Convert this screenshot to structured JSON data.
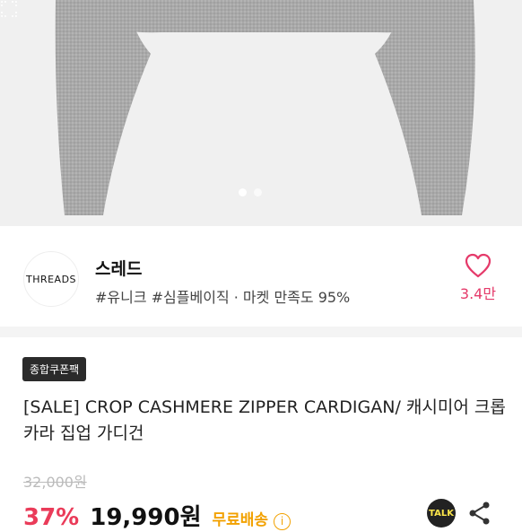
{
  "gallery": {
    "slide_count": 2,
    "active_slide": 1
  },
  "shop": {
    "logo_text": "THREADS",
    "name": "스레드",
    "tags": "#유니크 #심플베이직 · 마켓 만족도 95%",
    "like_count": "3.4만"
  },
  "product": {
    "badge": "종합쿠폰팩",
    "title": "[SALE] CROP CASHMERE ZIPPER CARDIGAN/ 캐시미어 크롭 카라 집업 가디건",
    "original_price": "32,000원",
    "discount": "37%",
    "price": "19,990원",
    "shipping": "무료배송",
    "info_icon": "i",
    "talk_label": "TALK"
  },
  "colors": {
    "accent_pink": "#e53a6a",
    "discount_red": "#ea3b59",
    "shipping_orange": "#f2a100"
  },
  "icons": [
    "heart-icon",
    "info-icon",
    "kakao-talk-icon",
    "share-icon",
    "expand-icon"
  ]
}
